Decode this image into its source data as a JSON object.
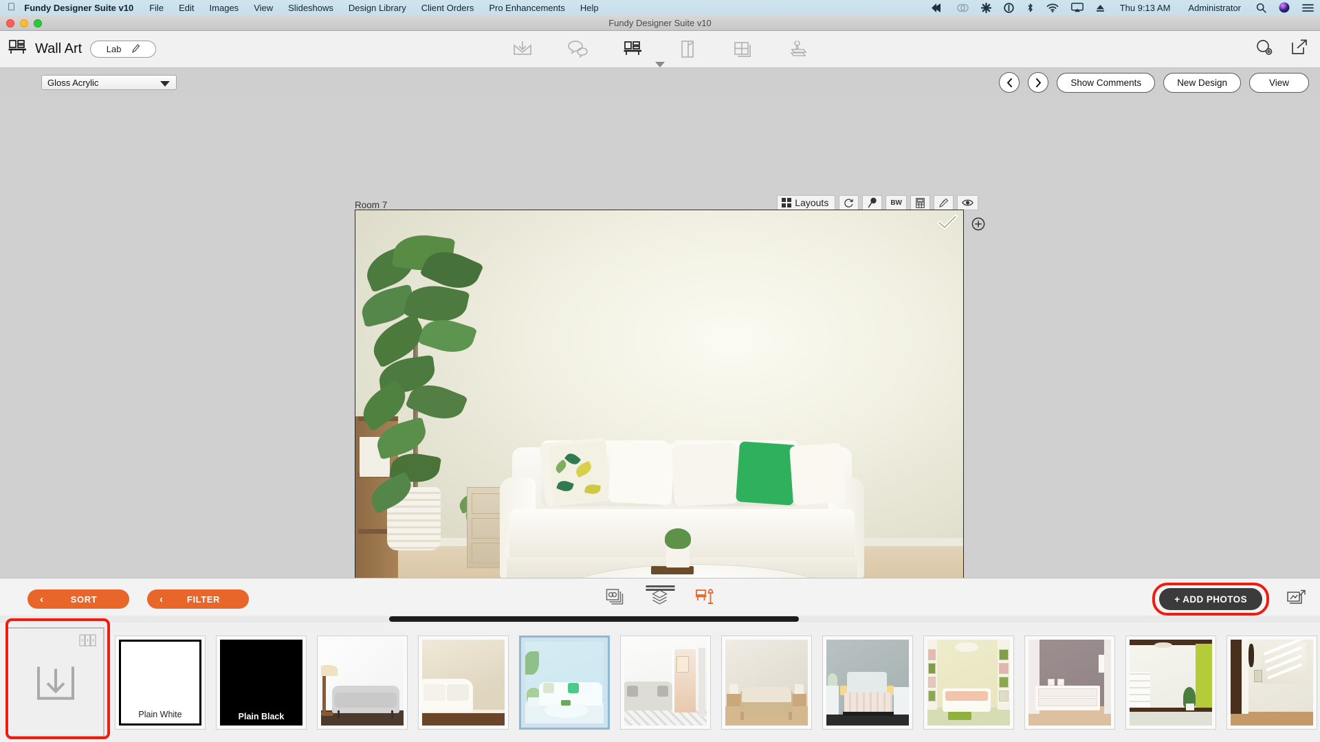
{
  "menubar": {
    "apple_icon": "apple-logo-icon",
    "app_name": "Fundy Designer Suite v10",
    "menus": [
      "File",
      "Edit",
      "Images",
      "View",
      "Slideshows",
      "Design Library",
      "Client Orders",
      "Pro Enhancements",
      "Help"
    ],
    "status_icons": [
      "fast-forward-icon",
      "creative-cloud-icon",
      "asterisk-icon",
      "power-circle-icon",
      "bluetooth-icon",
      "wifi-icon",
      "airplay-icon",
      "eject-icon"
    ],
    "clock": "Thu 9:13 AM",
    "user": "Administrator",
    "search_icon": "search-icon",
    "siri_icon": "siri-icon",
    "control_center_icon": "control-center-icon"
  },
  "window": {
    "title": "Fundy Designer Suite v10"
  },
  "toolbar": {
    "product_icon": "wall-art-icon",
    "product_label": "Wall Art",
    "lab_label": "Lab",
    "lab_edit_icon": "pencil-icon",
    "center_icons": [
      "import-icon",
      "comments-icon",
      "wall-art-icon",
      "album-icon",
      "layout-icon",
      "stamp-icon"
    ],
    "right_icons": [
      "settings-search-icon",
      "export-icon"
    ]
  },
  "subbar": {
    "material": "Gloss Acrylic",
    "dropdown_icon": "chevron-down-icon",
    "prev_icon": "chevron-left-icon",
    "next_icon": "chevron-right-icon",
    "show_comments": "Show Comments",
    "new_design": "New Design",
    "view": "View"
  },
  "canvas": {
    "room_label": "Room 7",
    "image_tools": [
      {
        "name": "layouts",
        "label": "Layouts",
        "icon": "grid-icon"
      },
      {
        "name": "rotate",
        "label": "",
        "icon": "rotate-icon"
      },
      {
        "name": "pin",
        "label": "",
        "icon": "pin-icon"
      },
      {
        "name": "bw",
        "label": "BW",
        "icon": "bw-icon"
      },
      {
        "name": "calculator",
        "label": "",
        "icon": "calculator-icon"
      },
      {
        "name": "ruler",
        "label": "",
        "icon": "ruler-icon"
      },
      {
        "name": "preview",
        "label": "",
        "icon": "eye-icon"
      }
    ],
    "approved_icon": "checkmark-icon",
    "add_icon": "plus-circle-icon"
  },
  "bottombar": {
    "sort_label": "SORT",
    "filter_label": "FILTER",
    "sort_chevron": "chevron-left-icon",
    "filter_chevron": "chevron-left-icon",
    "center_icons": [
      "photos-stack-icon",
      "layers-icon",
      "room-scene-icon"
    ],
    "active_center_icon": "room-scene-icon",
    "add_photos_label": "+ ADD PHOTOS",
    "export_icon": "export-images-icon",
    "accent_orange": "#e8662a",
    "highlight_red": "#f01c10",
    "dark_button": "#3b3b3b"
  },
  "tray": {
    "import_tile": {
      "name": "import-room",
      "icon": "download-icon",
      "books_icon": "books-icon",
      "highlighted": true
    },
    "items": [
      {
        "label": "Plain White",
        "kind": "plain-white",
        "selected": false
      },
      {
        "label": "Plain Black",
        "kind": "plain-black",
        "selected": false
      },
      {
        "label": "",
        "kind": "room-grey-sofa-lamp",
        "selected": false
      },
      {
        "label": "",
        "kind": "room-beige-white-sofa",
        "selected": false
      },
      {
        "label": "",
        "kind": "room-blue-living",
        "selected": true
      },
      {
        "label": "",
        "kind": "room-white-sectional-doorway",
        "selected": false
      },
      {
        "label": "",
        "kind": "room-beige-bedroom",
        "selected": false
      },
      {
        "label": "",
        "kind": "room-grey-bedroom",
        "selected": false
      },
      {
        "label": "",
        "kind": "room-kids-bedroom-green",
        "selected": false
      },
      {
        "label": "",
        "kind": "room-mauve-dresser",
        "selected": false
      },
      {
        "label": "",
        "kind": "room-stairs-green-wall",
        "selected": false
      },
      {
        "label": "",
        "kind": "room-hallway-stairs",
        "selected": false
      }
    ]
  },
  "colors": {
    "menubar_bg": "#cbe2ee",
    "toolbar_bg": "#f1f1f1",
    "subbar_bg": "#cfcfcf",
    "canvas_bg": "#d0d0d0",
    "selection_blue": "#8fb8d4"
  }
}
